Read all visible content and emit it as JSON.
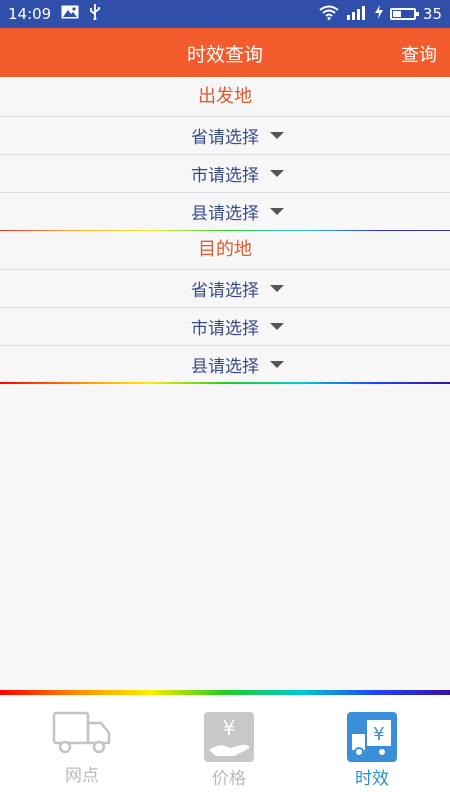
{
  "status_bar": {
    "time": "14:09",
    "battery_level": "35"
  },
  "header": {
    "title": "时效查询",
    "query_button": "查询"
  },
  "origin": {
    "title": "出发地",
    "rows": [
      {
        "prefix": "省",
        "value": "请选择"
      },
      {
        "prefix": "市",
        "value": "请选择"
      },
      {
        "prefix": "县",
        "value": "请选择"
      }
    ]
  },
  "destination": {
    "title": "目的地",
    "rows": [
      {
        "prefix": "省",
        "value": "请选择"
      },
      {
        "prefix": "市",
        "value": "请选择"
      },
      {
        "prefix": "县",
        "value": "请选择"
      }
    ]
  },
  "bottom_nav": {
    "items": [
      {
        "label": "网点",
        "icon": "truck-icon",
        "active": false
      },
      {
        "label": "价格",
        "icon": "price-hand-icon",
        "active": false
      },
      {
        "label": "时效",
        "icon": "timeliness-truck-icon",
        "active": true
      }
    ]
  },
  "colors": {
    "status_bar": "#2f4faa",
    "header": "#f25c2c",
    "section_title": "#e05a2b",
    "row_text": "#3a4b8c",
    "nav_active": "#2b8fd6",
    "nav_inactive": "#bbbbbb"
  }
}
